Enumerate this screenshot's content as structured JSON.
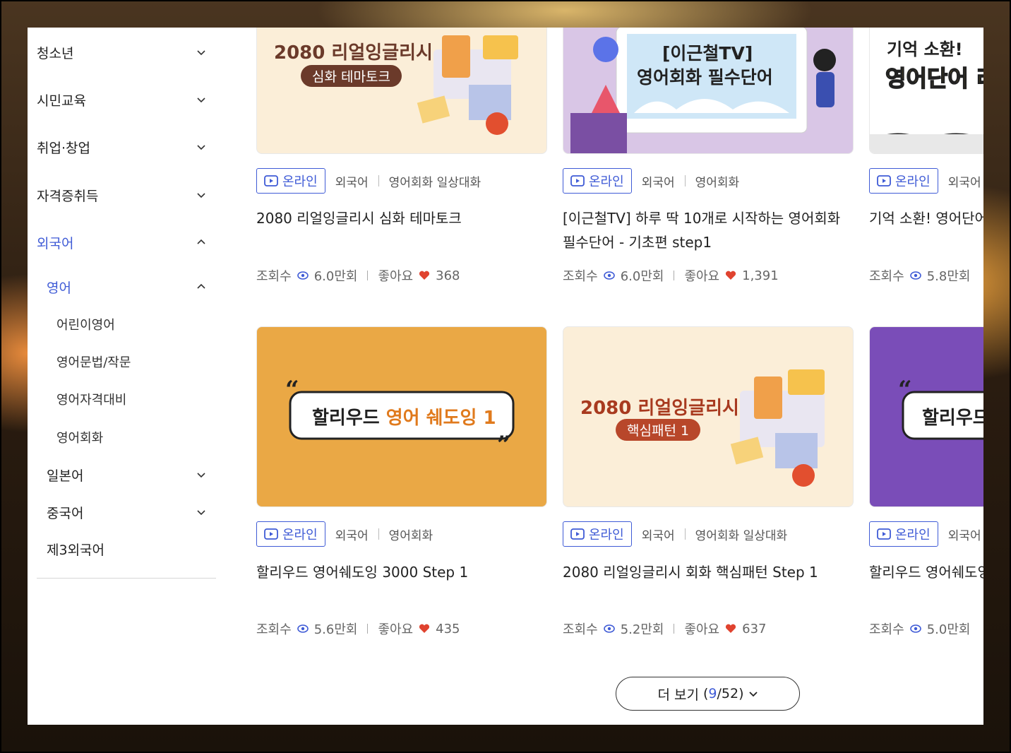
{
  "sidebar": {
    "items": [
      {
        "label": "청소년"
      },
      {
        "label": "시민교육"
      },
      {
        "label": "취업·창업"
      },
      {
        "label": "자격증취득"
      },
      {
        "label": "외국어"
      }
    ],
    "sub": [
      {
        "label": "영어"
      },
      {
        "label": "일본어"
      },
      {
        "label": "중국어"
      },
      {
        "label": "제3외국어"
      }
    ],
    "english_sub": [
      {
        "label": "어린이영어"
      },
      {
        "label": "영어문법/작문"
      },
      {
        "label": "영어자격대비"
      },
      {
        "label": "영어회화"
      }
    ]
  },
  "cards": [
    {
      "thumb": {
        "line1": "2080 리얼잉글리시",
        "line2": "심화 테마토크"
      },
      "badge": "온라인",
      "tags": [
        "외국어",
        "영어회화 일상대화"
      ],
      "title": "2080 리얼잉글리시 심화 테마토크",
      "views_label": "조회수",
      "views": "6.0만회",
      "likes_label": "좋아요",
      "likes": "368"
    },
    {
      "thumb": {
        "line1": "[이근철TV]",
        "line2": "영어회화 필수단어"
      },
      "badge": "온라인",
      "tags": [
        "외국어",
        "영어회화"
      ],
      "title": "[이근철TV] 하루 딱 10개로 시작하는 영어회화 필수단어 - 기초편 step1",
      "views_label": "조회수",
      "views": "6.0만회",
      "likes_label": "좋아요",
      "likes": "1,391"
    },
    {
      "thumb": {
        "line1": "기억 소환!",
        "line2": "영어단어 리"
      },
      "badge": "온라인",
      "tags": [
        "외국어"
      ],
      "title": "기억 소환! 영어단어",
      "views_label": "조회수",
      "views": "5.8만회"
    },
    {
      "thumb": {
        "line1": "할리우드",
        "line2": "영어 쉐도잉 1"
      },
      "badge": "온라인",
      "tags": [
        "외국어",
        "영어회화"
      ],
      "title": "할리우드 영어쉐도잉 3000 Step 1",
      "views_label": "조회수",
      "views": "5.6만회",
      "likes_label": "좋아요",
      "likes": "435"
    },
    {
      "thumb": {
        "line1": "2080 리얼잉글리시",
        "line2": "핵심패턴 1"
      },
      "badge": "온라인",
      "tags": [
        "외국어",
        "영어회화 일상대화"
      ],
      "title": "2080 리얼잉글리시 회화 핵심패턴 Step 1",
      "views_label": "조회수",
      "views": "5.2만회",
      "likes_label": "좋아요",
      "likes": "637"
    },
    {
      "thumb": {
        "line1": "할리우드"
      },
      "badge": "온라인",
      "tags": [
        "외국어"
      ],
      "title": "할리우드 영어쉐도잉",
      "views_label": "조회수",
      "views": "5.0만회"
    }
  ],
  "more": {
    "label": "더 보기",
    "open": "(",
    "current": "9",
    "slash": "/",
    "total": "52",
    "close": ")"
  },
  "colors": {
    "accent": "#3f5bd6",
    "heart": "#e0432f"
  }
}
